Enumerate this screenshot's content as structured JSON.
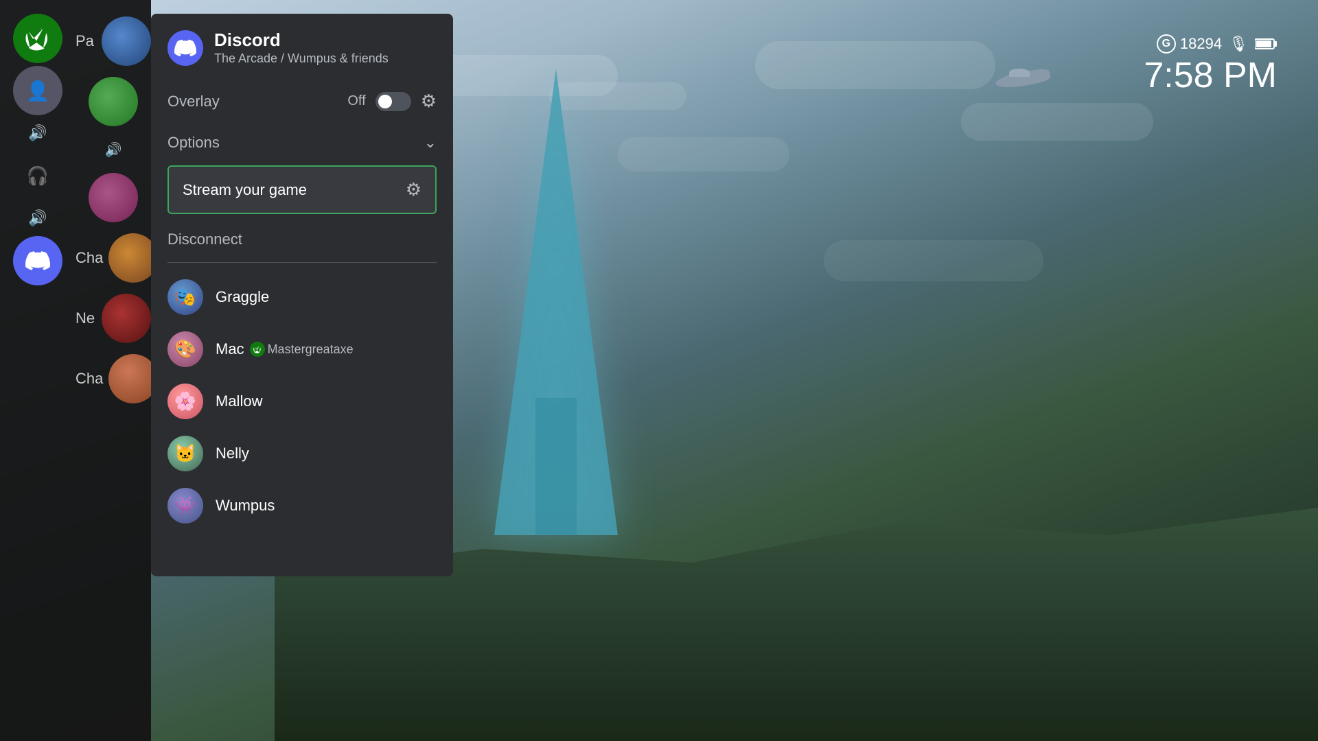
{
  "background": {
    "description": "Halo Infinite futuristic landscape with tall blue tower"
  },
  "statusBar": {
    "gamertag_icon": "G",
    "gp_count": "18294",
    "time": "7:58 PM"
  },
  "xboxSidebar": {
    "labels": [
      {
        "id": "pa",
        "text": "Pa"
      },
      {
        "id": "ne",
        "text": "Ne"
      },
      {
        "id": "cha1",
        "text": "Cha"
      },
      {
        "id": "cha2",
        "text": "Cha"
      }
    ]
  },
  "discordPanel": {
    "title": "Discord",
    "subtitle": "The Arcade / Wumpus & friends",
    "overlay": {
      "label": "Overlay",
      "state": "Off"
    },
    "options": {
      "label": "Options"
    },
    "streamButton": {
      "label": "Stream your game"
    },
    "disconnect": {
      "label": "Disconnect"
    },
    "members": [
      {
        "id": "graggle",
        "name": "Graggle",
        "xbox_gamertag": null,
        "avatar_class": "graggle"
      },
      {
        "id": "mac",
        "name": "Mac",
        "xbox_gamertag": "Mastergreataxe",
        "avatar_class": "mac"
      },
      {
        "id": "mallow",
        "name": "Mallow",
        "xbox_gamertag": null,
        "avatar_class": "mallow"
      },
      {
        "id": "nelly",
        "name": "Nelly",
        "xbox_gamertag": null,
        "avatar_class": "nelly"
      },
      {
        "id": "wumpus",
        "name": "Wumpus",
        "xbox_gamertag": null,
        "avatar_class": "wumpus"
      }
    ]
  },
  "colors": {
    "discord_accent": "#5865F2",
    "stream_border": "#3ba55c",
    "xbox_green": "#107C10",
    "panel_bg": "#2b2d31"
  }
}
